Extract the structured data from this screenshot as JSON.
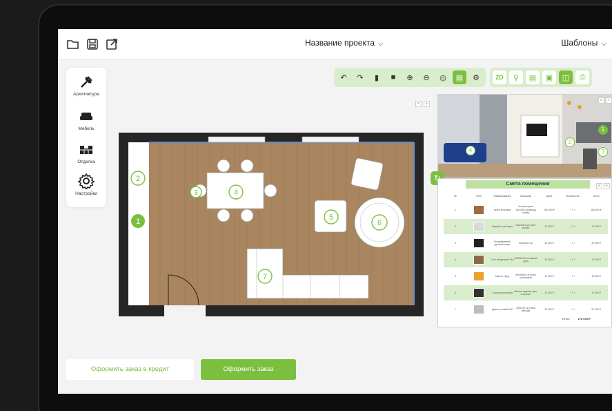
{
  "topbar": {
    "project_title": "Название проекта",
    "templates_label": "Шаблоны",
    "icons": [
      "folder-open-icon",
      "save-icon",
      "export-icon",
      "chevron-down-icon"
    ]
  },
  "sidebar": {
    "items": [
      {
        "label": "Архитектура",
        "icon": "tools-icon"
      },
      {
        "label": "Мебель",
        "icon": "sofa-icon"
      },
      {
        "label": "Отделка",
        "icon": "wall-icon"
      },
      {
        "label": "Настройки",
        "icon": "gear-icon"
      }
    ]
  },
  "toolbar": {
    "edit_tools": [
      "undo-icon",
      "redo-icon",
      "copy-icon",
      "delete-icon",
      "zoom-in-icon",
      "zoom-out-icon",
      "center-icon",
      "ruler-icon",
      "settings-icon"
    ],
    "view_2d_label": "2D",
    "view_tools": [
      "camera-icon",
      "clipboard-icon",
      "image-icon",
      "split-view-icon",
      "print-icon"
    ]
  },
  "floorplan": {
    "markers": [
      "1",
      "2",
      "3",
      "4",
      "5",
      "6",
      "7"
    ]
  },
  "photo_markers": [
    "1",
    "2",
    "3",
    "4"
  ],
  "estimate": {
    "title": "Смета помещения",
    "columns": [
      "№",
      "Фото",
      "Наименование",
      "Описание",
      "Цена",
      "Количество",
      "Итого"
    ],
    "rows": [
      {
        "n": "1",
        "name": "Кухня Итоговая",
        "desc": "Угловая кухня 160х260 см фасад глянец",
        "price": "180 000 ₽",
        "total": "180 000 ₽"
      },
      {
        "n": "2",
        "name": "Барный стул Кварт",
        "desc": "Барный стул, цвет белый",
        "price": "10 000 ₽",
        "total": "10 000 ₽"
      },
      {
        "n": "3",
        "name": "Встраиваемый духовой шкаф",
        "desc": "60х60х60 см",
        "price": "30 000 ₽",
        "total": "30 000 ₽"
      },
      {
        "n": "4",
        "name": "Стол обеденный Sky",
        "desc": "120х80х75 см массив дуба",
        "price": "15 000 ₽",
        "total": "15 000 ₽"
      },
      {
        "n": "5",
        "name": "Кресло Норд",
        "desc": "80х80х80 см ткань оранжевая",
        "price": "15 000 ₽",
        "total": "15 000 ₽"
      },
      {
        "n": "6",
        "name": "Стул классический",
        "desc": "Мягкое сиденье цвет антрацит",
        "price": "12 000 ₽",
        "total": "12 000 ₽"
      },
      {
        "n": "7",
        "name": "Диван угловой Кэб",
        "desc": "260х160 см ткань светлая",
        "price": "22 000 ₽",
        "total": "22 000 ₽"
      }
    ],
    "total_label": "Итого",
    "total_value": "278 000 ₽"
  },
  "buttons": {
    "credit_label": "Оформить заказ в кредит",
    "order_label": "Оформить заказ"
  },
  "colors": {
    "accent": "#7cbf3f",
    "accent_light": "#d9edcc",
    "wall": "#262626",
    "floor": "#a9865f"
  }
}
